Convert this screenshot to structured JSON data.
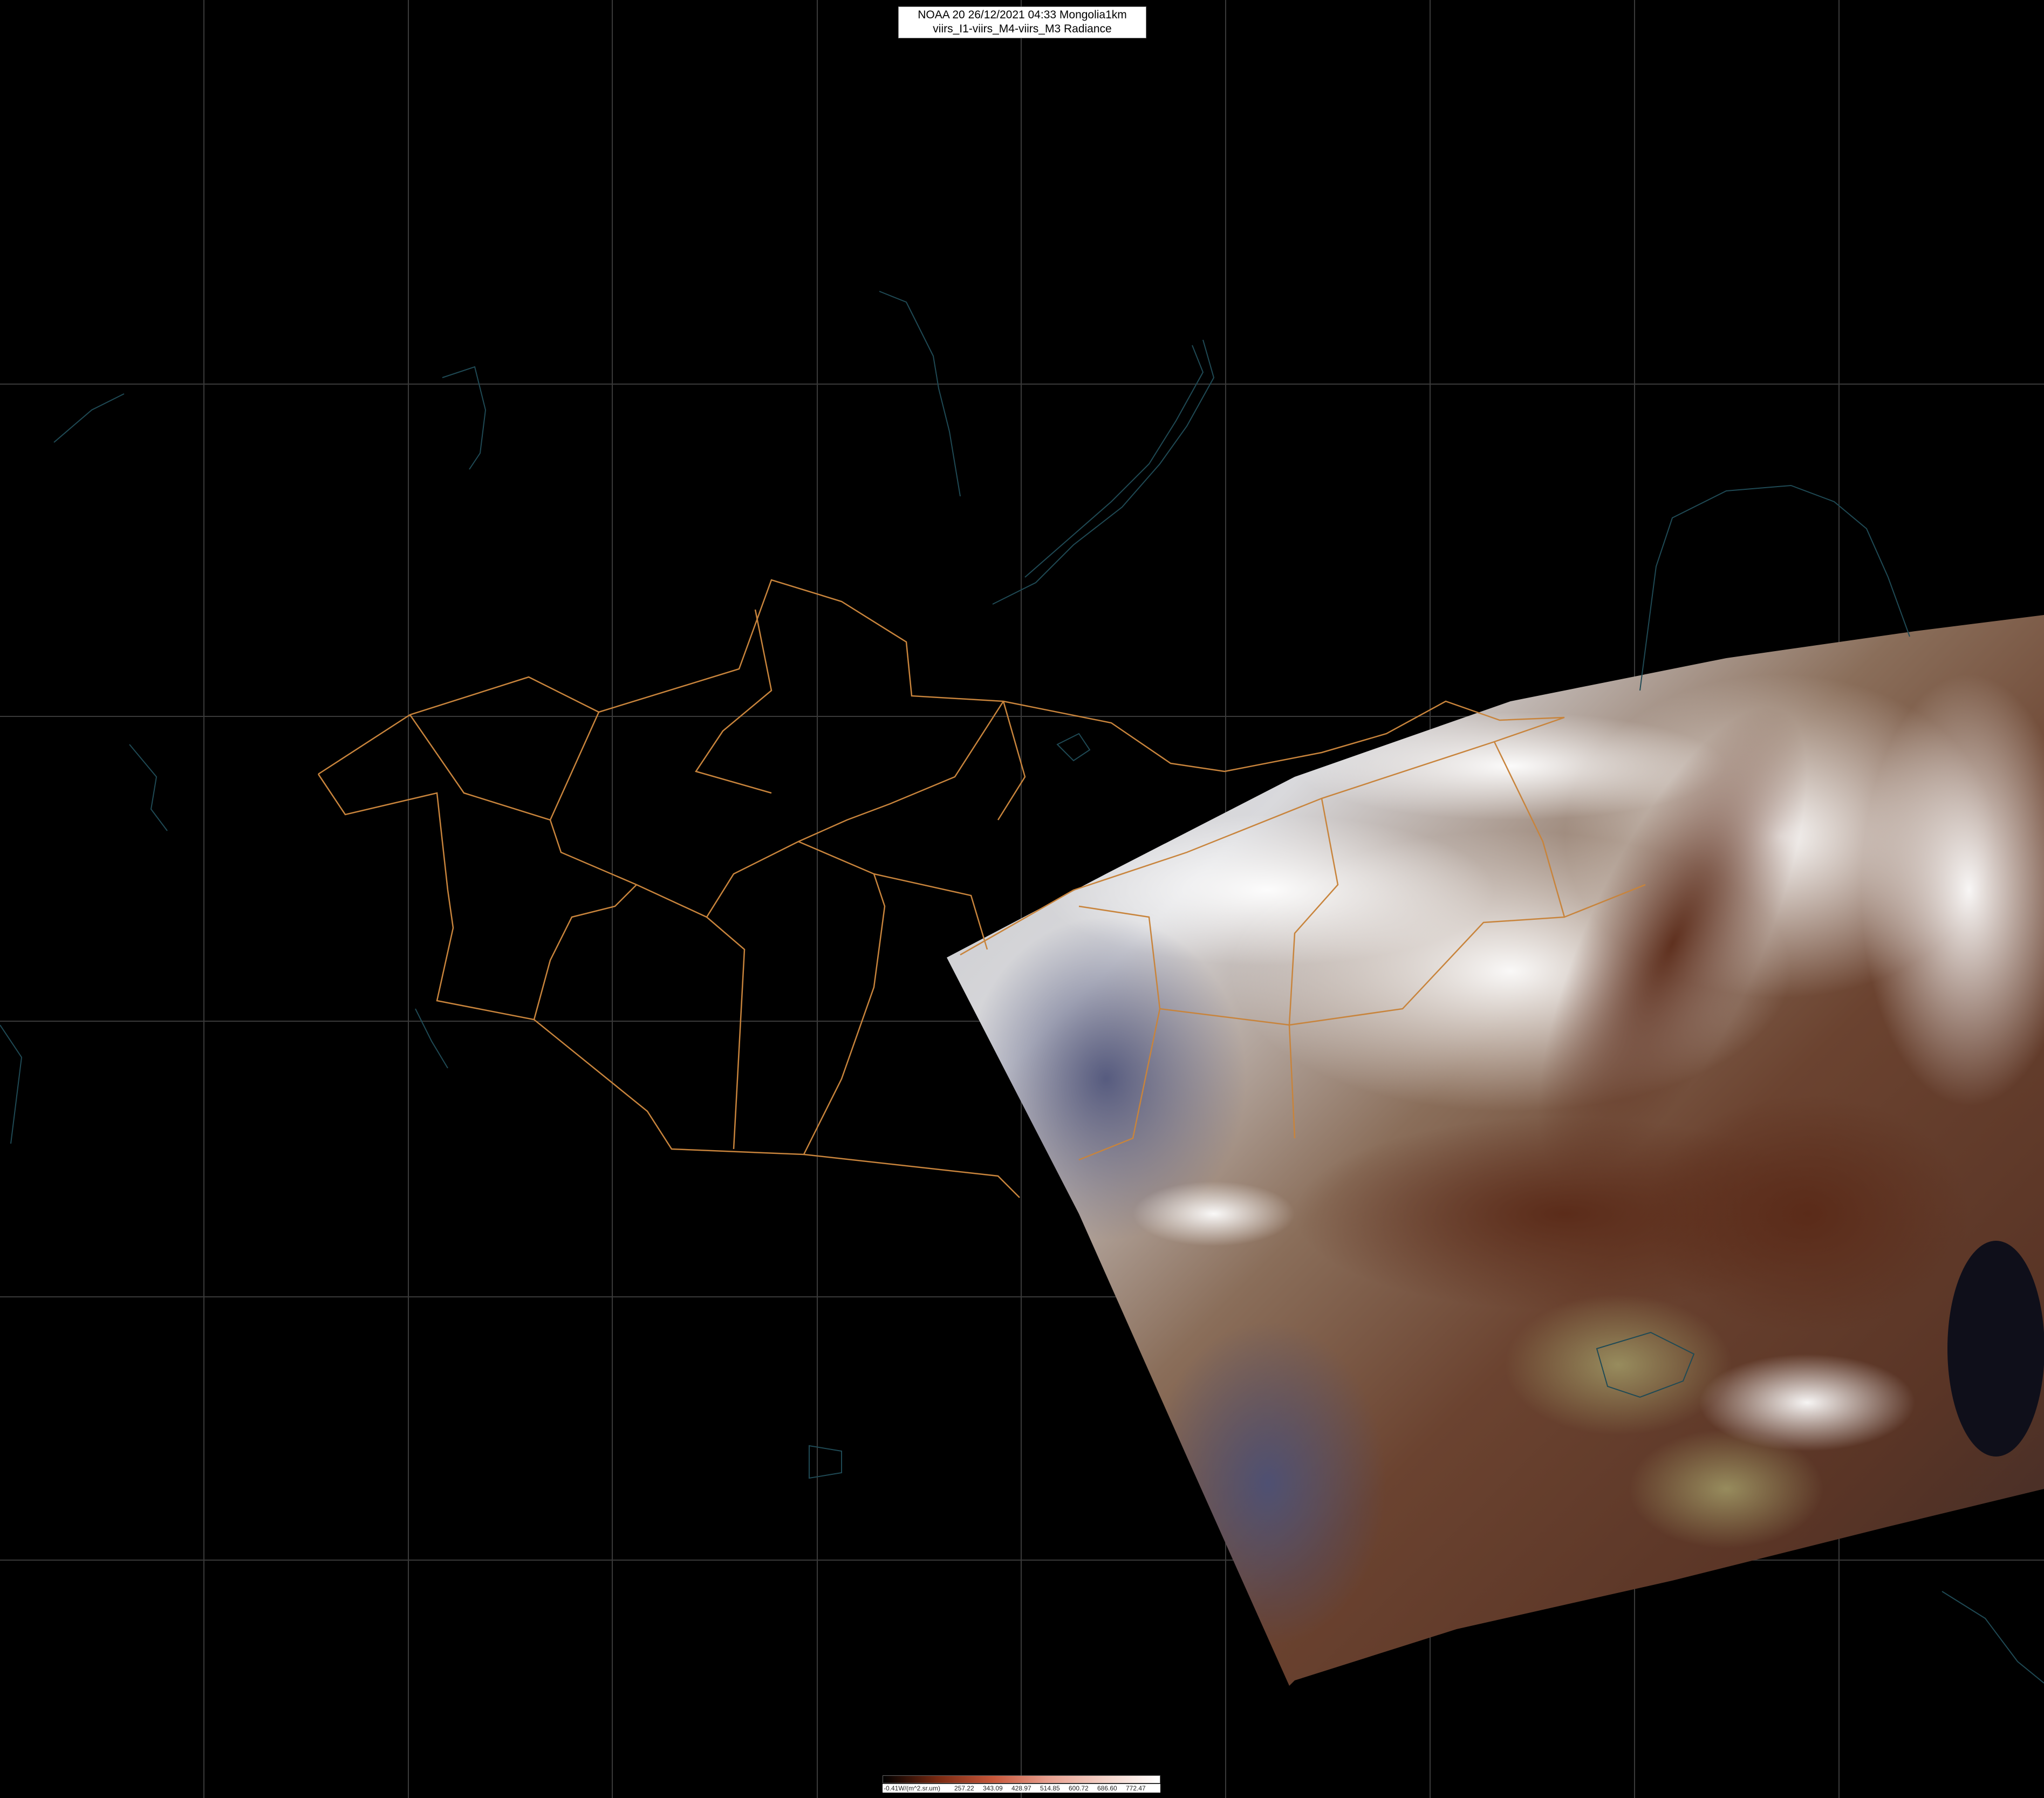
{
  "map": {
    "title_line1": "NOAA 20 26/12/2021 04:33 Mongolia1km",
    "title_line2": "viirs_I1-viirs_M4-viirs_M3 Radiance",
    "colors": {
      "background": "#000000",
      "graticule": "#3a3a3a",
      "borders": "#c8843c",
      "coastlines": "#1f4a55"
    }
  },
  "legend": {
    "unit_label": "-0.41W/(m^2.sr.um)",
    "ticks": [
      "257.22",
      "343.09",
      "428.97",
      "514.85",
      "600.72",
      "686.60",
      "772.47"
    ],
    "colors": [
      "#000000",
      "#7a2a12",
      "#c8573a",
      "#e8a090",
      "#f4d2c8",
      "#ffffff"
    ]
  }
}
